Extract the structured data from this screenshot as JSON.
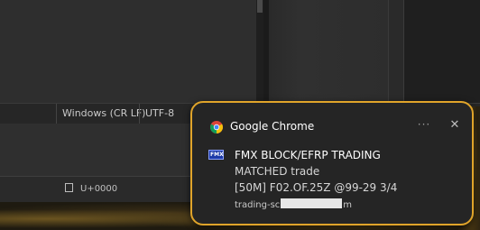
{
  "status_bar": {
    "line_ending": "Windows (CR LF)",
    "encoding": "UTF-8",
    "codepoint": "U+0000"
  },
  "notification": {
    "app_name": "Google Chrome",
    "app_icon": "chrome-icon",
    "more_label": "···",
    "close_label": "✕",
    "sender_icon_text": "FMX",
    "title": "FMX BLOCK/EFRP TRADING",
    "lines": [
      "MATCHED trade",
      "[50M] F02.OF.25Z @99-29 3/4"
    ],
    "attribution_prefix": "trading-sc",
    "attribution_suffix": "m",
    "accent_color": "#e0a42a"
  }
}
